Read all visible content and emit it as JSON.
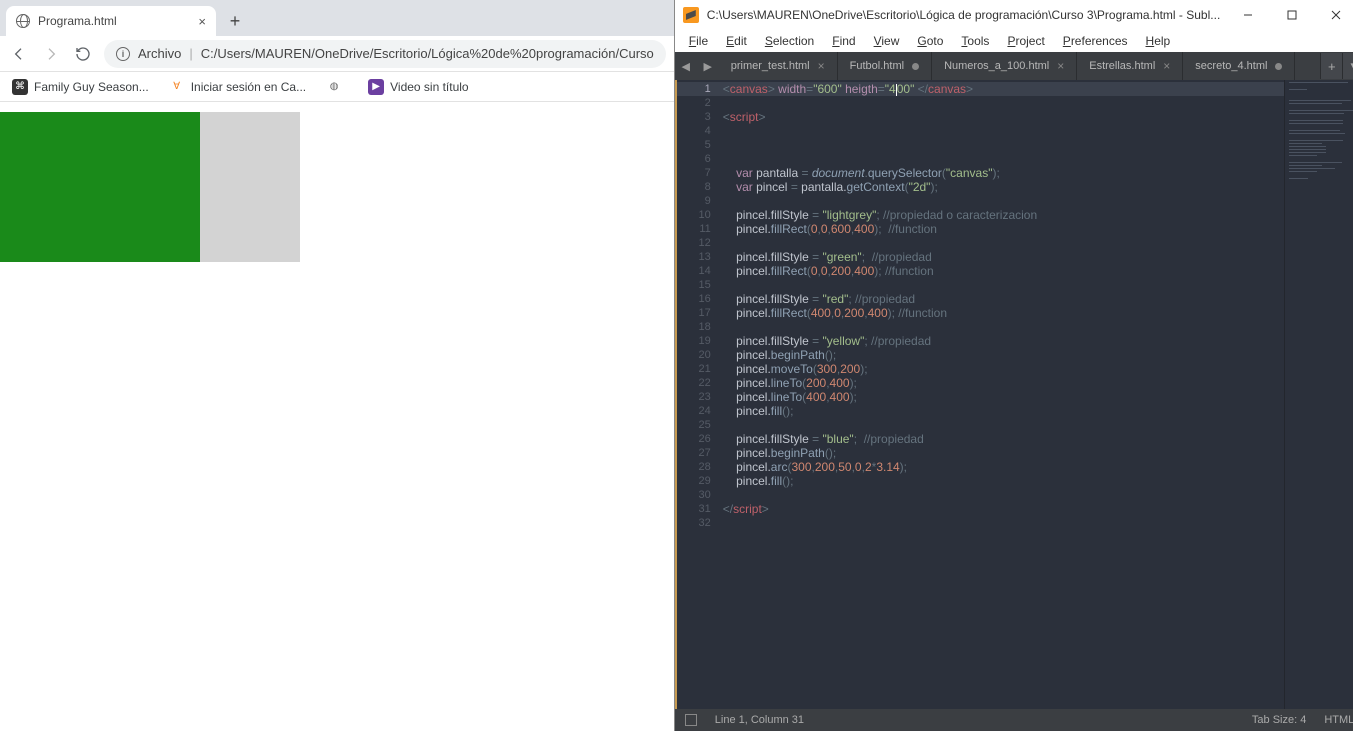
{
  "chrome": {
    "tab_title": "Programa.html",
    "url_label": "Archivo",
    "url_path": "C:/Users/MAUREN/OneDrive/Escritorio/Lógica%20de%20programación/Curso",
    "bookmarks": [
      {
        "label": "Family Guy Season...",
        "icon_bg": "#333",
        "icon_fg": "#fff",
        "icon_txt": "⌘"
      },
      {
        "label": "Iniciar sesión en Ca...",
        "icon_bg": "#fff",
        "icon_fg": "#f58220",
        "icon_txt": "Ɐ"
      },
      {
        "label": "",
        "icon_bg": "#fff",
        "icon_fg": "#666",
        "icon_txt": "◍"
      },
      {
        "label": "Video sin título",
        "icon_bg": "#6b3fa0",
        "icon_fg": "#fff",
        "icon_txt": "▶"
      }
    ]
  },
  "sublime": {
    "title": "C:\\Users\\MAUREN\\OneDrive\\Escritorio\\Lógica de programación\\Curso 3\\Programa.html - Subl...",
    "menu": [
      "File",
      "Edit",
      "Selection",
      "Find",
      "View",
      "Goto",
      "Tools",
      "Project",
      "Preferences",
      "Help"
    ],
    "tabs": [
      {
        "name": "primer_test.html",
        "indicator": "close",
        "active": false
      },
      {
        "name": "Futbol.html",
        "indicator": "dirty",
        "active": false
      },
      {
        "name": "Numeros_a_100.html",
        "indicator": "close",
        "active": false
      },
      {
        "name": "Estrellas.html",
        "indicator": "close",
        "active": false
      },
      {
        "name": "secreto_4.html",
        "indicator": "dirty",
        "active": false
      }
    ],
    "status_left": "Line 1, Column 31",
    "status_tab": "Tab Size: 4",
    "status_lang": "HTML",
    "lines": 32,
    "code": [
      {
        "n": 1,
        "seg": [
          [
            "<",
            "c-grey"
          ],
          [
            "canvas",
            "c-red"
          ],
          [
            "> ",
            "c-grey"
          ],
          [
            "width",
            "c-purple"
          ],
          [
            "=",
            "c-grey"
          ],
          [
            "\"600\"",
            "c-green"
          ],
          [
            " heigth",
            "c-purple"
          ],
          [
            "=",
            "c-grey"
          ],
          [
            "\"4",
            "c-green"
          ],
          [
            "CURSOR",
            ""
          ],
          [
            "00\"",
            "c-green"
          ],
          [
            " </",
            "c-grey"
          ],
          [
            "canvas",
            "c-red"
          ],
          [
            ">",
            "c-grey"
          ]
        ]
      },
      {
        "n": 2,
        "seg": []
      },
      {
        "n": 3,
        "seg": [
          [
            "<",
            "c-grey"
          ],
          [
            "script",
            "c-red"
          ],
          [
            ">",
            "c-grey"
          ]
        ]
      },
      {
        "n": 4,
        "seg": []
      },
      {
        "n": 5,
        "seg": []
      },
      {
        "n": 6,
        "seg": []
      },
      {
        "n": 7,
        "seg": [
          [
            "    ",
            ""
          ],
          [
            "var",
            "c-purple"
          ],
          [
            " pantalla ",
            "c0"
          ],
          [
            "= ",
            "c-grey"
          ],
          [
            "document",
            "c-blue c-ital"
          ],
          [
            ".",
            "c-grey"
          ],
          [
            "querySelector",
            "c-blue"
          ],
          [
            "(",
            "c-grey"
          ],
          [
            "\"canvas\"",
            "c-green"
          ],
          [
            ");",
            "c-grey"
          ]
        ]
      },
      {
        "n": 8,
        "seg": [
          [
            "    ",
            ""
          ],
          [
            "var",
            "c-purple"
          ],
          [
            " pincel ",
            "c0"
          ],
          [
            "= ",
            "c-grey"
          ],
          [
            "pantalla.",
            "c0"
          ],
          [
            "getContext",
            "c-blue"
          ],
          [
            "(",
            "c-grey"
          ],
          [
            "\"2d\"",
            "c-green"
          ],
          [
            ");",
            "c-grey"
          ]
        ]
      },
      {
        "n": 9,
        "seg": []
      },
      {
        "n": 10,
        "seg": [
          [
            "    pincel.fillStyle ",
            "c0"
          ],
          [
            "= ",
            "c-grey"
          ],
          [
            "\"lightgrey\"",
            "c-green"
          ],
          [
            "; ",
            "c-grey"
          ],
          [
            "//propiedad o caracterizacion",
            "c-grey"
          ]
        ]
      },
      {
        "n": 11,
        "seg": [
          [
            "    pincel.",
            "c0"
          ],
          [
            "fillRect",
            "c-blue"
          ],
          [
            "(",
            "c-grey"
          ],
          [
            "0",
            "c-orange"
          ],
          [
            ",",
            "c-grey"
          ],
          [
            "0",
            "c-orange"
          ],
          [
            ",",
            "c-grey"
          ],
          [
            "600",
            "c-orange"
          ],
          [
            ",",
            "c-grey"
          ],
          [
            "400",
            "c-orange"
          ],
          [
            ");  ",
            "c-grey"
          ],
          [
            "//function",
            "c-grey"
          ]
        ]
      },
      {
        "n": 12,
        "seg": []
      },
      {
        "n": 13,
        "seg": [
          [
            "    pincel.fillStyle ",
            "c0"
          ],
          [
            "= ",
            "c-grey"
          ],
          [
            "\"green\"",
            "c-green"
          ],
          [
            ";  ",
            "c-grey"
          ],
          [
            "//propiedad",
            "c-grey"
          ]
        ]
      },
      {
        "n": 14,
        "seg": [
          [
            "    pincel.",
            "c0"
          ],
          [
            "fillRect",
            "c-blue"
          ],
          [
            "(",
            "c-grey"
          ],
          [
            "0",
            "c-orange"
          ],
          [
            ",",
            "c-grey"
          ],
          [
            "0",
            "c-orange"
          ],
          [
            ",",
            "c-grey"
          ],
          [
            "200",
            "c-orange"
          ],
          [
            ",",
            "c-grey"
          ],
          [
            "400",
            "c-orange"
          ],
          [
            "); ",
            "c-grey"
          ],
          [
            "//function",
            "c-grey"
          ]
        ]
      },
      {
        "n": 15,
        "seg": []
      },
      {
        "n": 16,
        "seg": [
          [
            "    pincel.fillStyle ",
            "c0"
          ],
          [
            "= ",
            "c-grey"
          ],
          [
            "\"red\"",
            "c-green"
          ],
          [
            "; ",
            "c-grey"
          ],
          [
            "//propiedad",
            "c-grey"
          ]
        ]
      },
      {
        "n": 17,
        "seg": [
          [
            "    pincel.",
            "c0"
          ],
          [
            "fillRect",
            "c-blue"
          ],
          [
            "(",
            "c-grey"
          ],
          [
            "400",
            "c-orange"
          ],
          [
            ",",
            "c-grey"
          ],
          [
            "0",
            "c-orange"
          ],
          [
            ",",
            "c-grey"
          ],
          [
            "200",
            "c-orange"
          ],
          [
            ",",
            "c-grey"
          ],
          [
            "400",
            "c-orange"
          ],
          [
            "); ",
            "c-grey"
          ],
          [
            "//function",
            "c-grey"
          ]
        ]
      },
      {
        "n": 18,
        "seg": []
      },
      {
        "n": 19,
        "seg": [
          [
            "    pincel.fillStyle ",
            "c0"
          ],
          [
            "= ",
            "c-grey"
          ],
          [
            "\"yellow\"",
            "c-green"
          ],
          [
            "; ",
            "c-grey"
          ],
          [
            "//propiedad",
            "c-grey"
          ]
        ]
      },
      {
        "n": 20,
        "seg": [
          [
            "    pincel.",
            "c0"
          ],
          [
            "beginPath",
            "c-blue"
          ],
          [
            "();",
            "c-grey"
          ]
        ]
      },
      {
        "n": 21,
        "seg": [
          [
            "    pincel.",
            "c0"
          ],
          [
            "moveTo",
            "c-blue"
          ],
          [
            "(",
            "c-grey"
          ],
          [
            "300",
            "c-orange"
          ],
          [
            ",",
            "c-grey"
          ],
          [
            "200",
            "c-orange"
          ],
          [
            ");",
            "c-grey"
          ]
        ]
      },
      {
        "n": 22,
        "seg": [
          [
            "    pincel.",
            "c0"
          ],
          [
            "lineTo",
            "c-blue"
          ],
          [
            "(",
            "c-grey"
          ],
          [
            "200",
            "c-orange"
          ],
          [
            ",",
            "c-grey"
          ],
          [
            "400",
            "c-orange"
          ],
          [
            ");",
            "c-grey"
          ]
        ]
      },
      {
        "n": 23,
        "seg": [
          [
            "    pincel.",
            "c0"
          ],
          [
            "lineTo",
            "c-blue"
          ],
          [
            "(",
            "c-grey"
          ],
          [
            "400",
            "c-orange"
          ],
          [
            ",",
            "c-grey"
          ],
          [
            "400",
            "c-orange"
          ],
          [
            ");",
            "c-grey"
          ]
        ]
      },
      {
        "n": 24,
        "seg": [
          [
            "    pincel.",
            "c0"
          ],
          [
            "fill",
            "c-blue"
          ],
          [
            "();",
            "c-grey"
          ]
        ]
      },
      {
        "n": 25,
        "seg": []
      },
      {
        "n": 26,
        "seg": [
          [
            "    pincel.fillStyle ",
            "c0"
          ],
          [
            "= ",
            "c-grey"
          ],
          [
            "\"blue\"",
            "c-green"
          ],
          [
            ";  ",
            "c-grey"
          ],
          [
            "//propiedad",
            "c-grey"
          ]
        ]
      },
      {
        "n": 27,
        "seg": [
          [
            "    pincel.",
            "c0"
          ],
          [
            "beginPath",
            "c-blue"
          ],
          [
            "();",
            "c-grey"
          ]
        ]
      },
      {
        "n": 28,
        "seg": [
          [
            "    pincel.",
            "c0"
          ],
          [
            "arc",
            "c-blue"
          ],
          [
            "(",
            "c-grey"
          ],
          [
            "300",
            "c-orange"
          ],
          [
            ",",
            "c-grey"
          ],
          [
            "200",
            "c-orange"
          ],
          [
            ",",
            "c-grey"
          ],
          [
            "50",
            "c-orange"
          ],
          [
            ",",
            "c-grey"
          ],
          [
            "0",
            "c-orange"
          ],
          [
            ",",
            "c-grey"
          ],
          [
            "2",
            "c-orange"
          ],
          [
            "*",
            "c-grey"
          ],
          [
            "3.14",
            "c-orange"
          ],
          [
            ");",
            "c-grey"
          ]
        ]
      },
      {
        "n": 29,
        "seg": [
          [
            "    pincel.",
            "c0"
          ],
          [
            "fill",
            "c-blue"
          ],
          [
            "();",
            "c-grey"
          ]
        ]
      },
      {
        "n": 30,
        "seg": []
      },
      {
        "n": 31,
        "seg": [
          [
            "</",
            "c-grey"
          ],
          [
            "script",
            "c-red"
          ],
          [
            ">",
            "c-grey"
          ]
        ]
      },
      {
        "n": 32,
        "seg": []
      }
    ]
  }
}
